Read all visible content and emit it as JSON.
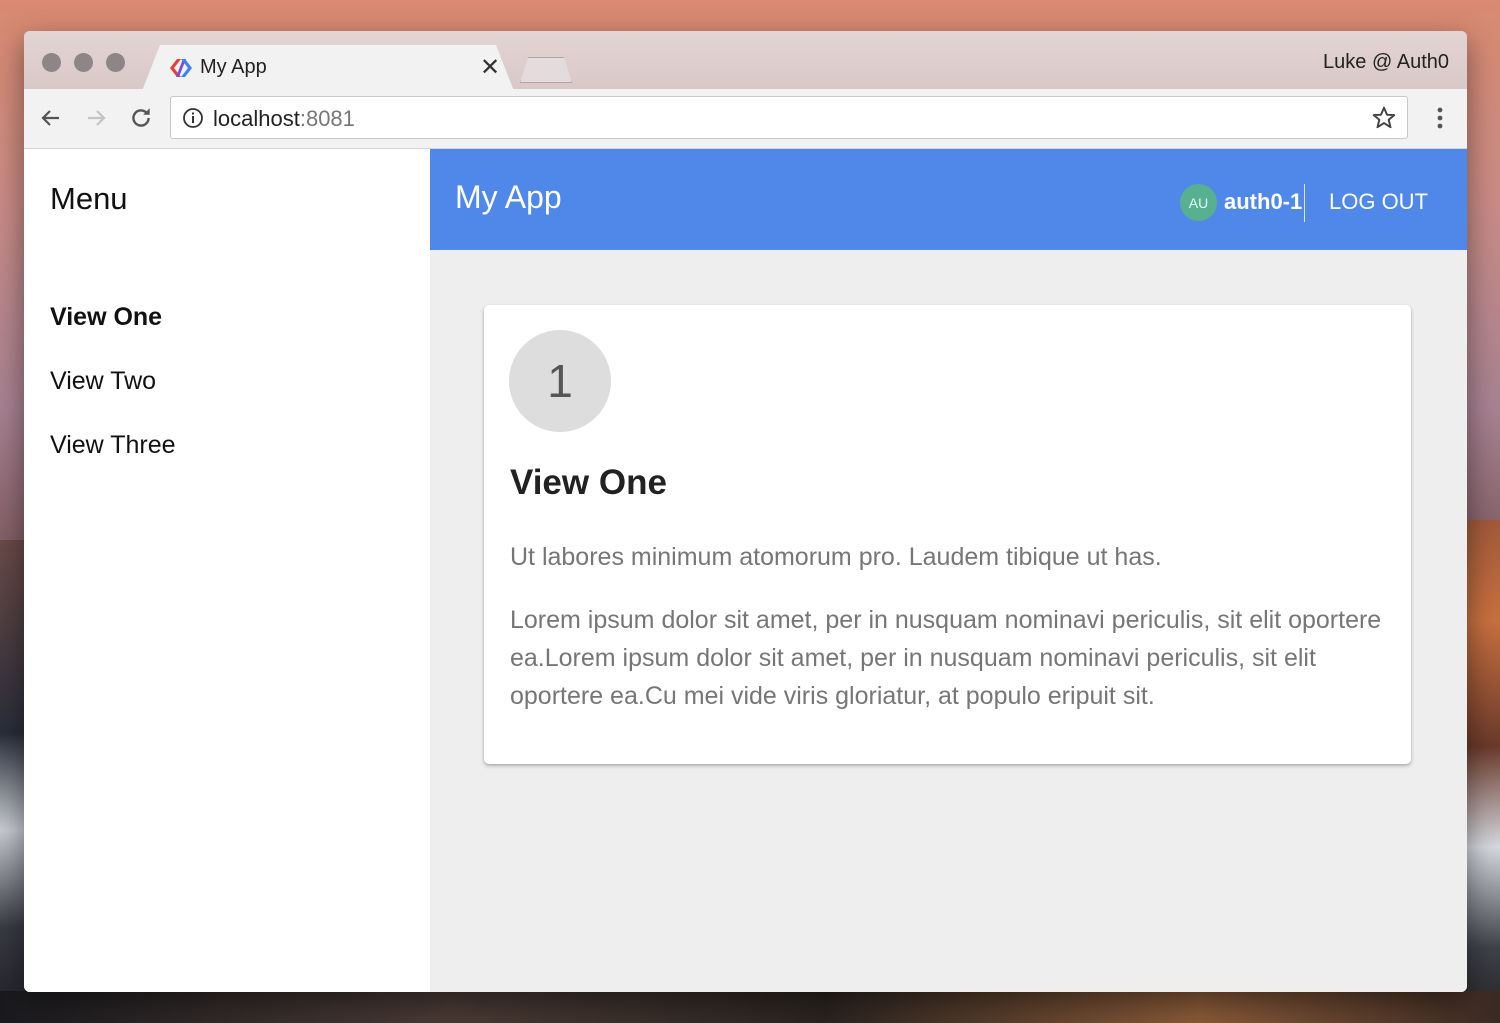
{
  "browser": {
    "tab_title": "My App",
    "tab_close": "✕",
    "profile_label": "Luke @ Auth0",
    "url_host": "localhost",
    "url_port": ":8081"
  },
  "sidebar": {
    "title": "Menu",
    "items": [
      {
        "label": "View One",
        "active": true
      },
      {
        "label": "View Two",
        "active": false
      },
      {
        "label": "View Three",
        "active": false
      }
    ]
  },
  "appbar": {
    "title": "My App",
    "avatar_initials": "AU",
    "username": "auth0-1",
    "logout_label": "LOG OUT",
    "color": "#5088ea"
  },
  "card": {
    "number": "1",
    "title": "View One",
    "paragraph1": "Ut labores minimum atomorum pro. Laudem tibique ut has.",
    "paragraph2": "Lorem ipsum dolor sit amet, per in nusquam nominavi periculis, sit elit oportere ea.Lorem ipsum dolor sit amet, per in nusquam nominavi periculis, sit elit oportere ea.Cu mei vide viris gloriatur, at populo eripuit sit."
  },
  "icons": [
    "back-arrow-icon",
    "forward-arrow-icon",
    "reload-icon",
    "info-icon",
    "star-icon",
    "more-vert-icon",
    "app-favicon-icon"
  ]
}
